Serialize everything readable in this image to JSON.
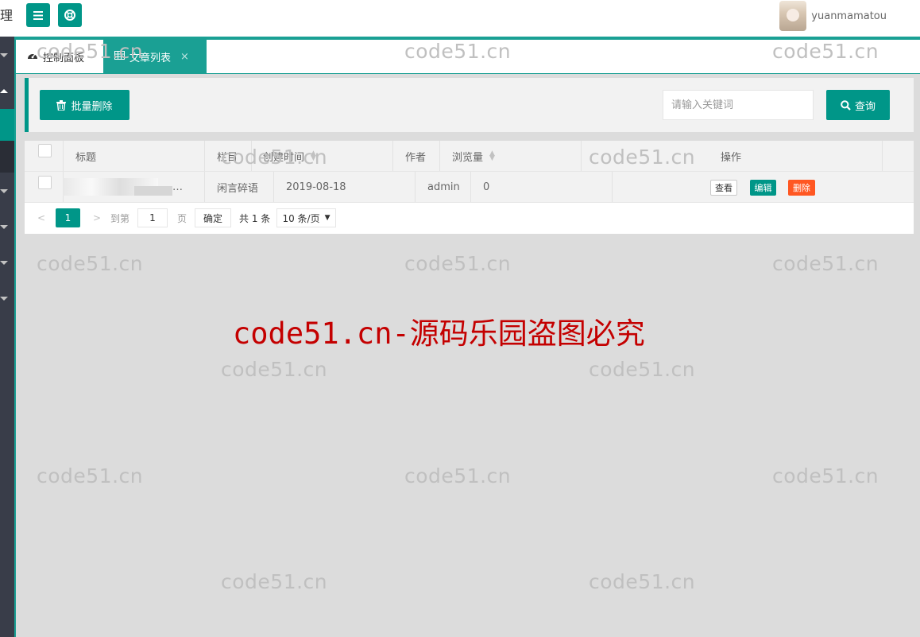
{
  "header": {
    "brand_fragment": "理",
    "menu_icon": "hamburger-icon",
    "help_icon": "lifebuoy-icon",
    "username": "yuanmamatou"
  },
  "tabs": [
    {
      "label": "控制面板",
      "icon": "dashboard-icon",
      "active": false
    },
    {
      "label": "文章列表",
      "icon": "table-icon",
      "active": true,
      "close": "×"
    }
  ],
  "toolbar": {
    "batch_delete_label": "批量删除",
    "search_placeholder": "请输入关键词",
    "search_label": "查询"
  },
  "table": {
    "headers": {
      "title": "标题",
      "column": "栏目",
      "created": "创建时间",
      "author": "作者",
      "views": "浏览量",
      "actions": "操作"
    },
    "rows": [
      {
        "title_tail": "…",
        "column": "闲言碎语",
        "created": "2019-08-18",
        "author": "admin",
        "views": "0",
        "actions": {
          "view": "查看",
          "edit": "编辑",
          "delete": "删除"
        }
      }
    ]
  },
  "pager": {
    "prev": "<",
    "current": "1",
    "next": ">",
    "goto_label": "到第",
    "goto_value": "1",
    "page_unit": "页",
    "confirm": "确定",
    "total": "共 1 条",
    "page_size": "10 条/页"
  },
  "watermark": {
    "text": "code51.cn",
    "notice": "code51.cn-源码乐园盗图必究"
  },
  "colors": {
    "primary": "#009688",
    "sidebar": "#393d49",
    "danger": "#ff5722",
    "notice": "#c40000"
  }
}
